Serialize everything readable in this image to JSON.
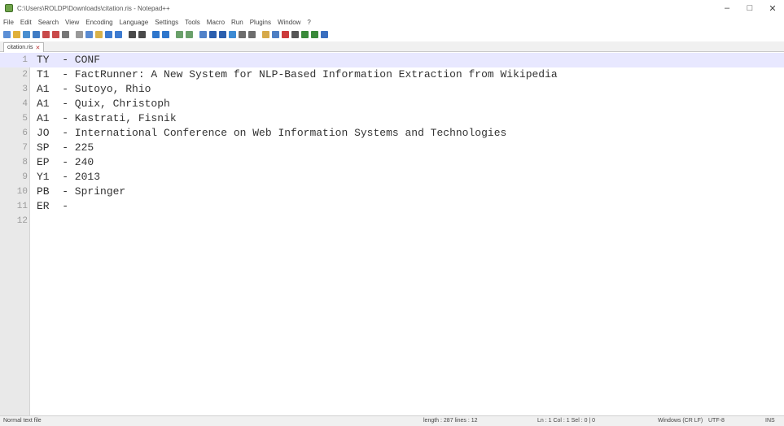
{
  "window": {
    "title": "C:\\Users\\ROLDP\\Downloads\\citation.ris - Notepad++",
    "controls": {
      "minimize": "–",
      "maximize": "□",
      "close": "✕"
    }
  },
  "menu": {
    "items": [
      "File",
      "Edit",
      "Search",
      "View",
      "Encoding",
      "Language",
      "Settings",
      "Tools",
      "Macro",
      "Run",
      "Plugins",
      "Window",
      "?"
    ]
  },
  "toolbar": {
    "buttons": [
      "new-file-icon",
      "open-file-icon",
      "save-icon",
      "save-all-icon",
      "close-icon",
      "close-all-icon",
      "print-icon",
      "cut-icon",
      "copy-icon",
      "paste-icon",
      "undo-icon",
      "redo-icon",
      "find-icon",
      "replace-icon",
      "zoom-in-icon",
      "zoom-out-icon",
      "sync-v-icon",
      "sync-h-icon",
      "wrap-icon",
      "all-chars-icon",
      "indent-guide-icon",
      "lang-icon",
      "doc-map-icon",
      "function-list-icon",
      "folder-icon",
      "monitor-icon",
      "record-icon",
      "stop-icon",
      "play-icon",
      "play-multi-icon",
      "save-macro-icon"
    ]
  },
  "tab": {
    "label": "citation.ris",
    "close": "✕"
  },
  "editor": {
    "current_line": 1,
    "lines": [
      {
        "num": "1",
        "text": "TY  - CONF"
      },
      {
        "num": "2",
        "text": "T1  - FactRunner: A New System for NLP-Based Information Extraction from Wikipedia"
      },
      {
        "num": "3",
        "text": "A1  - Sutoyo, Rhio"
      },
      {
        "num": "4",
        "text": "A1  - Quix, Christoph"
      },
      {
        "num": "5",
        "text": "A1  - Kastrati, Fisnik"
      },
      {
        "num": "6",
        "text": "JO  - International Conference on Web Information Systems and Technologies"
      },
      {
        "num": "7",
        "text": "SP  - 225"
      },
      {
        "num": "8",
        "text": "EP  - 240"
      },
      {
        "num": "9",
        "text": "Y1  - 2013"
      },
      {
        "num": "10",
        "text": "PB  - Springer"
      },
      {
        "num": "11",
        "text": "ER  -"
      },
      {
        "num": "12",
        "text": ""
      }
    ]
  },
  "status": {
    "file_type": "Normal text file",
    "length": "length : 287    lines : 12",
    "position": "Ln : 1    Col : 1    Sel : 0 | 0",
    "eol": "Windows (CR LF)",
    "encoding": "UTF-8",
    "mode": "INS"
  },
  "colors": {
    "gutter_bg": "#e9e9e9",
    "current_line_bg": "#e8e8ff",
    "text": "#333333"
  }
}
